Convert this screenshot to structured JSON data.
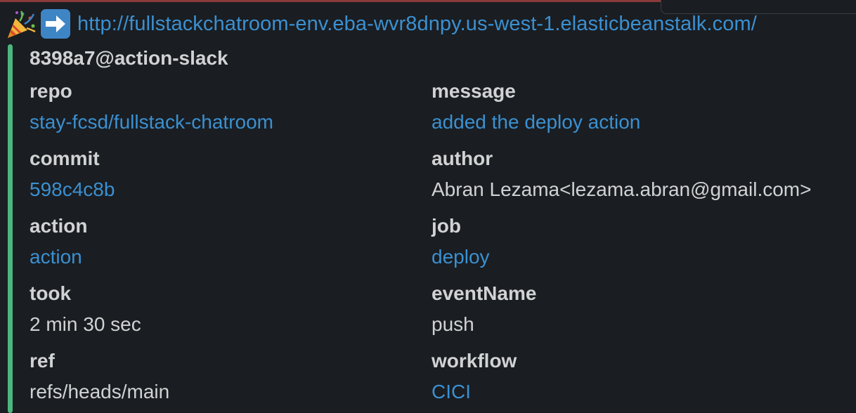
{
  "header": {
    "emojis": [
      "party-popper-icon",
      "right-arrow-icon"
    ],
    "url": "http://fullstackchatroom-env.eba-wvr8dnpy.us-west-1.elasticbeanstalk.com/"
  },
  "attachment": {
    "accent_color": "#4bb67e",
    "title": "8398a7@action-slack",
    "fields": {
      "repo": {
        "label": "repo",
        "value": "stay-fcsd/fullstack-chatroom"
      },
      "message": {
        "label": "message",
        "value": "added the deploy action"
      },
      "commit": {
        "label": "commit",
        "value": "598c4c8b"
      },
      "author": {
        "label": "author",
        "value": "Abran Lezama<lezama.abran@gmail.com>"
      },
      "action": {
        "label": "action",
        "value": "action"
      },
      "job": {
        "label": "job",
        "value": "deploy"
      },
      "took": {
        "label": "took",
        "value": "2 min 30 sec"
      },
      "eventName": {
        "label": "eventName",
        "value": "push"
      },
      "ref": {
        "label": "ref",
        "value": "refs/heads/main"
      },
      "workflow": {
        "label": "workflow",
        "value": "CICI"
      }
    }
  },
  "colors": {
    "background": "#1a1d21",
    "link": "#3b90d1",
    "text": "#d1d2d3"
  }
}
